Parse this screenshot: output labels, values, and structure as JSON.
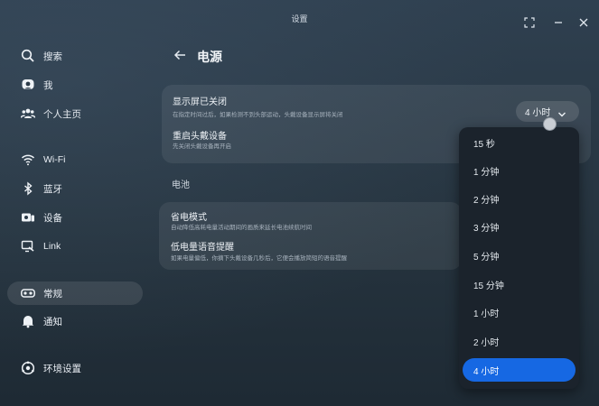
{
  "window": {
    "title": "设置"
  },
  "sidebar": {
    "items": [
      {
        "label": "搜索",
        "icon": "search-icon"
      },
      {
        "label": "我",
        "icon": "profile-icon"
      },
      {
        "label": "个人主页",
        "icon": "people-icon"
      },
      {
        "label": "Wi-Fi",
        "icon": "wifi-icon"
      },
      {
        "label": "蓝牙",
        "icon": "bluetooth-icon"
      },
      {
        "label": "设备",
        "icon": "devices-icon"
      },
      {
        "label": "Link",
        "icon": "link-icon"
      },
      {
        "label": "常规",
        "icon": "headset-icon",
        "active": true
      },
      {
        "label": "通知",
        "icon": "bell-icon"
      },
      {
        "label": "环境设置",
        "icon": "environment-icon"
      }
    ]
  },
  "page": {
    "title": "电源"
  },
  "display_card": {
    "display_off_title": "显示屏已关闭",
    "display_off_desc": "在指定时间过后，如果检测不到头部运动，头戴设备显示屏将关闭",
    "restart_title": "重启头戴设备",
    "restart_desc": "先关闭头戴设备再开启",
    "selected_value": "4 小时"
  },
  "battery_section": {
    "label": "电池",
    "power_saving_title": "省电模式",
    "power_saving_desc": "自动降低高耗电量活动期间的画质来延长电池续航时间",
    "low_battery_title": "低电量语音提醒",
    "low_battery_desc": "如果电量偏低，你摘下头戴设备几秒后，它便会播放简短的语音提醒"
  },
  "dropdown": {
    "options": [
      "15 秒",
      "1 分钟",
      "2 分钟",
      "3 分钟",
      "5 分钟",
      "15 分钟",
      "1 小时",
      "2 小时",
      "4 小时"
    ],
    "selected_index": 8
  },
  "colors": {
    "accent": "#1668e3",
    "dropdown_bg": "#1b232c"
  }
}
